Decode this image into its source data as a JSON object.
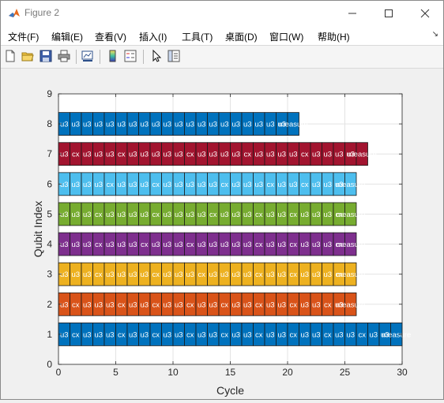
{
  "window": {
    "title": "Figure 2",
    "minimize_icon": "minimize-icon",
    "maximize_icon": "maximize-icon",
    "close_icon": "close-icon"
  },
  "menu": {
    "items": [
      "文件(F)",
      "编辑(E)",
      "查看(V)",
      "插入(I)",
      "工具(T)",
      "桌面(D)",
      "窗口(W)",
      "帮助(H)"
    ],
    "overflow_arrow": "↘"
  },
  "toolbar": {
    "icons": [
      "new-figure-icon",
      "open-file-icon",
      "save-icon",
      "print-icon",
      "link-plot-icon",
      "colorbar-icon",
      "legend-icon",
      "pointer-icon",
      "property-inspector-icon"
    ]
  },
  "chart_data": {
    "type": "bar",
    "orientation": "horizontal-gantt",
    "xlabel": "Cycle",
    "ylabel": "Qubit Index",
    "xlim": [
      0,
      30
    ],
    "ylim": [
      0,
      9
    ],
    "xticks": [
      0,
      5,
      10,
      15,
      20,
      25,
      30
    ],
    "yticks": [
      0,
      1,
      2,
      3,
      4,
      5,
      6,
      7,
      8,
      9
    ],
    "grid": true,
    "series": [
      {
        "qubit": 1,
        "color": "#0072BD",
        "ops": [
          "u3",
          "cx",
          "u3",
          "u3",
          "u3",
          "cx",
          "u3",
          "u3",
          "cx",
          "u3",
          "u3",
          "cx",
          "u3",
          "u3",
          "cx",
          "u3",
          "u3",
          "cx",
          "u3",
          "u3",
          "cx",
          "u3",
          "u3",
          "cx",
          "u3",
          "u3",
          "cx",
          "u3",
          "u3",
          "measure"
        ]
      },
      {
        "qubit": 2,
        "color": "#D95319",
        "ops": [
          "u3",
          "cx",
          "u3",
          "u3",
          "u3",
          "cx",
          "u3",
          "u3",
          "cx",
          "u3",
          "u3",
          "cx",
          "u3",
          "u3",
          "cx",
          "u3",
          "u3",
          "cx",
          "u3",
          "u3",
          "cx",
          "u3",
          "u3",
          "cx",
          "u3",
          "measure"
        ]
      },
      {
        "qubit": 3,
        "color": "#EDB120",
        "ops": [
          "u3",
          "u3",
          "u3",
          "cx",
          "u3",
          "u3",
          "u3",
          "u3",
          "cx",
          "u3",
          "u3",
          "u3",
          "cx",
          "u3",
          "u3",
          "u3",
          "u3",
          "cx",
          "u3",
          "u3",
          "cx",
          "u3",
          "u3",
          "u3",
          "cx",
          "measure"
        ]
      },
      {
        "qubit": 4,
        "color": "#7E2F8E",
        "ops": [
          "u3",
          "u3",
          "u3",
          "cx",
          "u3",
          "u3",
          "u3",
          "cx",
          "u3",
          "u3",
          "u3",
          "cx",
          "u3",
          "u3",
          "u3",
          "u3",
          "u3",
          "cx",
          "u3",
          "u3",
          "cx",
          "u3",
          "u3",
          "u3",
          "cx",
          "measure"
        ]
      },
      {
        "qubit": 5,
        "color": "#77AC30",
        "ops": [
          "u3",
          "u3",
          "u3",
          "cx",
          "u3",
          "u3",
          "u3",
          "u3",
          "cx",
          "u3",
          "u3",
          "u3",
          "u3",
          "cx",
          "u3",
          "u3",
          "u3",
          "cx",
          "u3",
          "u3",
          "cx",
          "u3",
          "u3",
          "u3",
          "cx",
          "measure"
        ]
      },
      {
        "qubit": 6,
        "color": "#4DBEEE",
        "ops": [
          "u3",
          "u3",
          "u3",
          "u3",
          "cx",
          "u3",
          "u3",
          "u3",
          "cx",
          "u3",
          "u3",
          "u3",
          "u3",
          "u3",
          "cx",
          "u3",
          "u3",
          "u3",
          "cx",
          "u3",
          "u3",
          "cx",
          "u3",
          "u3",
          "u3",
          "measure"
        ]
      },
      {
        "qubit": 7,
        "color": "#A2142F",
        "ops": [
          "u3",
          "cx",
          "u3",
          "u3",
          "u3",
          "cx",
          "u3",
          "u3",
          "u3",
          "u3",
          "u3",
          "cx",
          "u3",
          "u3",
          "u3",
          "u3",
          "cx",
          "u3",
          "u3",
          "u3",
          "u3",
          "cx",
          "u3",
          "u3",
          "u3",
          "u3",
          "measure"
        ]
      },
      {
        "qubit": 8,
        "color": "#0072BD",
        "ops": [
          "u3",
          "u3",
          "u3",
          "u3",
          "u3",
          "u3",
          "u3",
          "u3",
          "u3",
          "u3",
          "u3",
          "u3",
          "u3",
          "u3",
          "u3",
          "u3",
          "u3",
          "u3",
          "u3",
          "u3",
          "measure"
        ]
      }
    ]
  }
}
